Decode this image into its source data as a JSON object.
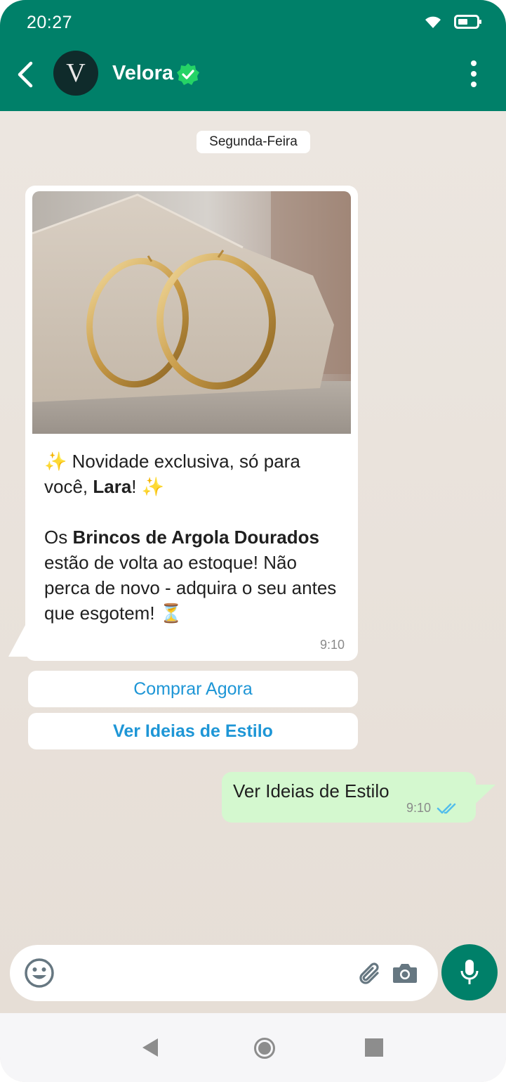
{
  "status_bar": {
    "time": "20:27"
  },
  "header": {
    "avatar_letter": "V",
    "contact_name": "Velora"
  },
  "chat": {
    "date_chip": "Segunda-Feira",
    "incoming": {
      "line1_pre": "✨ Novidade exclusiva, só para você, ",
      "line1_bold": "Lara",
      "line1_post": "! ✨",
      "line2_pre": "Os ",
      "line2_bold": "Brincos de Argola Dourados",
      "line2_post": " estão de volta ao estoque! Não perca de novo - adquira o seu antes que esgotem! ⏳",
      "time": "9:10"
    },
    "quick_replies": [
      "Comprar Agora",
      "Ver Ideias de Estilo"
    ],
    "outgoing": {
      "text": "Ver Ideias de Estilo",
      "time": "9:10"
    }
  },
  "colors": {
    "header": "#008069",
    "outgoing_bubble": "#D4F8CF",
    "link": "#1E96D6",
    "chat_bg": "#ECE5DD"
  },
  "icons": [
    "back-arrow-icon",
    "verified-badge-icon",
    "more-vert-icon",
    "wifi-icon",
    "battery-icon",
    "emoji-icon",
    "attach-icon",
    "camera-icon",
    "mic-icon",
    "double-check-icon",
    "nav-back-icon",
    "nav-home-icon",
    "nav-recents-icon"
  ]
}
